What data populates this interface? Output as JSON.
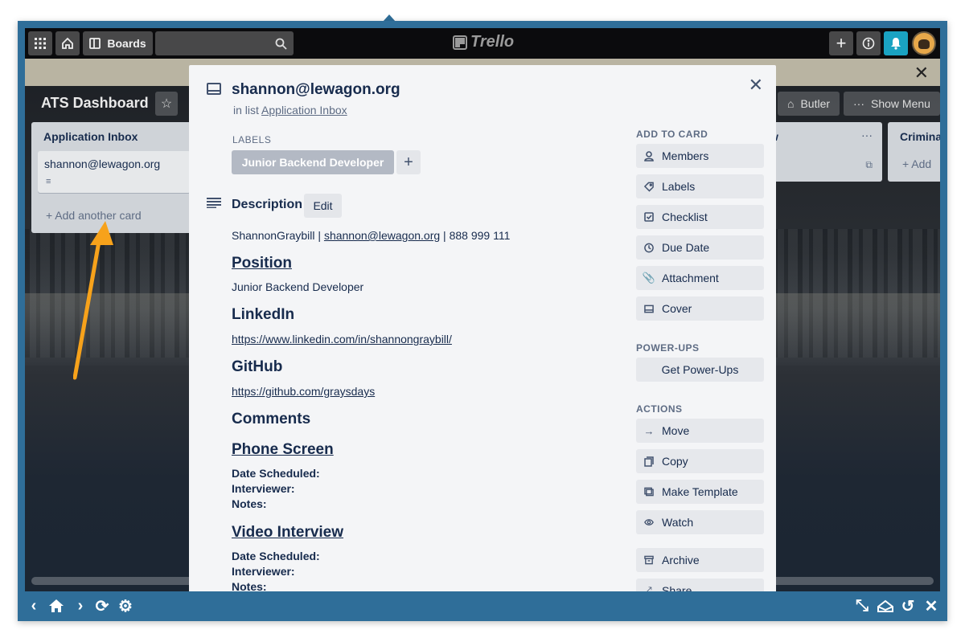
{
  "topbar": {
    "boards_label": "Boards",
    "logo_text": "Trello"
  },
  "board": {
    "title": "ATS Dashboard",
    "butler_label": "Butler",
    "show_menu_label": "Show Menu"
  },
  "lists": [
    {
      "title": "Application Inbox",
      "card": "shannon@lewagon.org",
      "add_card": "Add another card"
    },
    {
      "title": "w"
    },
    {
      "title": "Crimina",
      "add_partial": "Add"
    }
  ],
  "card_modal": {
    "title": "shannon@lewagon.org",
    "in_list_prefix": "in list",
    "list_name": "Application Inbox",
    "labels_heading": "LABELS",
    "label": "Junior Backend Developer",
    "description_heading": "Description",
    "edit_label": "Edit",
    "contact_name": "ShannonGraybill | ",
    "contact_email": "shannon@lewagon.org",
    "contact_phone": " | 888 999 111",
    "position_heading": "Position",
    "position_value": "Junior Backend Developer",
    "linkedin_heading": "LinkedIn",
    "linkedin_url": "https://www.linkedin.com/in/shannongraybill/",
    "github_heading": "GitHub",
    "github_url": "https://github.com/graysdays",
    "comments_heading": "Comments",
    "phone_screen_heading": "Phone Screen",
    "video_interview_heading": "Video Interview",
    "date_scheduled": "Date Scheduled:",
    "interviewer": "Interviewer:",
    "notes": "Notes:"
  },
  "sidebar": {
    "add_to_card_heading": "ADD TO CARD",
    "add_to_card": [
      "Members",
      "Labels",
      "Checklist",
      "Due Date",
      "Attachment",
      "Cover"
    ],
    "power_ups_heading": "POWER-UPS",
    "get_power_ups": "Get Power-Ups",
    "actions_heading": "ACTIONS",
    "actions": [
      "Move",
      "Copy",
      "Make Template",
      "Watch",
      "Archive",
      "Share"
    ]
  },
  "colors": {
    "frame": "#2f6e99",
    "arrow": "#f7a21b",
    "modal_bg": "#f4f5f7",
    "label_bg": "#b3b9c4"
  }
}
